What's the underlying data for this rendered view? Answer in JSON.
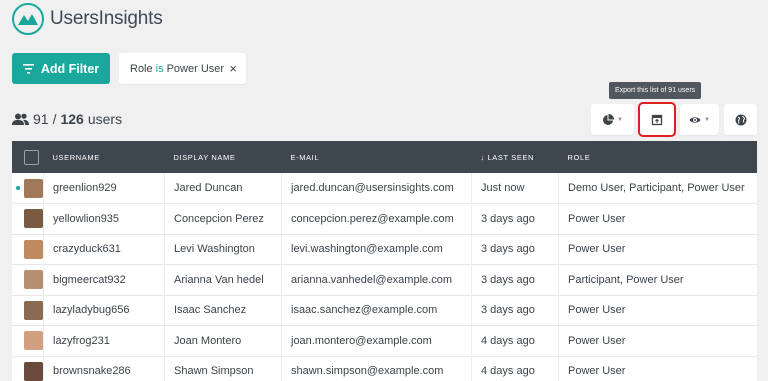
{
  "app": {
    "name": "UsersInsights",
    "accent": "#1aa89c"
  },
  "toolbar": {
    "add_filter_label": "Add Filter",
    "filter": {
      "field": "Role",
      "operator": "is",
      "value": "Power User",
      "remove": "×"
    },
    "count": {
      "shown": "91",
      "separator": " / ",
      "total": "126",
      "unit": " users"
    },
    "export_tooltip": "Export this list of 91 users",
    "buttons": [
      "segments-icon",
      "export-icon",
      "visible-columns-icon",
      "map-icon"
    ]
  },
  "table": {
    "headers": {
      "username": "USERNAME",
      "display_name": "DISPLAY NAME",
      "email": "E-MAIL",
      "last_seen": "↓ LAST SEEN",
      "role": "ROLE"
    },
    "rows": [
      {
        "username": "greenlion929",
        "display_name": "Jared Duncan",
        "email": "jared.duncan@usersinsights.com",
        "last_seen": "Just now",
        "role": "Demo User, Participant, Power User",
        "online": true
      },
      {
        "username": "yellowlion935",
        "display_name": "Concepcion Perez",
        "email": "concepcion.perez@example.com",
        "last_seen": "3 days ago",
        "role": "Power User"
      },
      {
        "username": "crazyduck631",
        "display_name": "Levi Washington",
        "email": "levi.washington@example.com",
        "last_seen": "3 days ago",
        "role": "Power User"
      },
      {
        "username": "bigmeercat932",
        "display_name": "Arianna Van hedel",
        "email": "arianna.vanhedel@example.com",
        "last_seen": "3 days ago",
        "role": "Participant, Power User"
      },
      {
        "username": "lazyladybug656",
        "display_name": "Isaac Sanchez",
        "email": "isaac.sanchez@example.com",
        "last_seen": "3 days ago",
        "role": "Power User"
      },
      {
        "username": "lazyfrog231",
        "display_name": "Joan Montero",
        "email": "joan.montero@example.com",
        "last_seen": "4 days ago",
        "role": "Power User"
      },
      {
        "username": "brownsnake286",
        "display_name": "Shawn Simpson",
        "email": "shawn.simpson@example.com",
        "last_seen": "4 days ago",
        "role": "Power User"
      }
    ]
  }
}
